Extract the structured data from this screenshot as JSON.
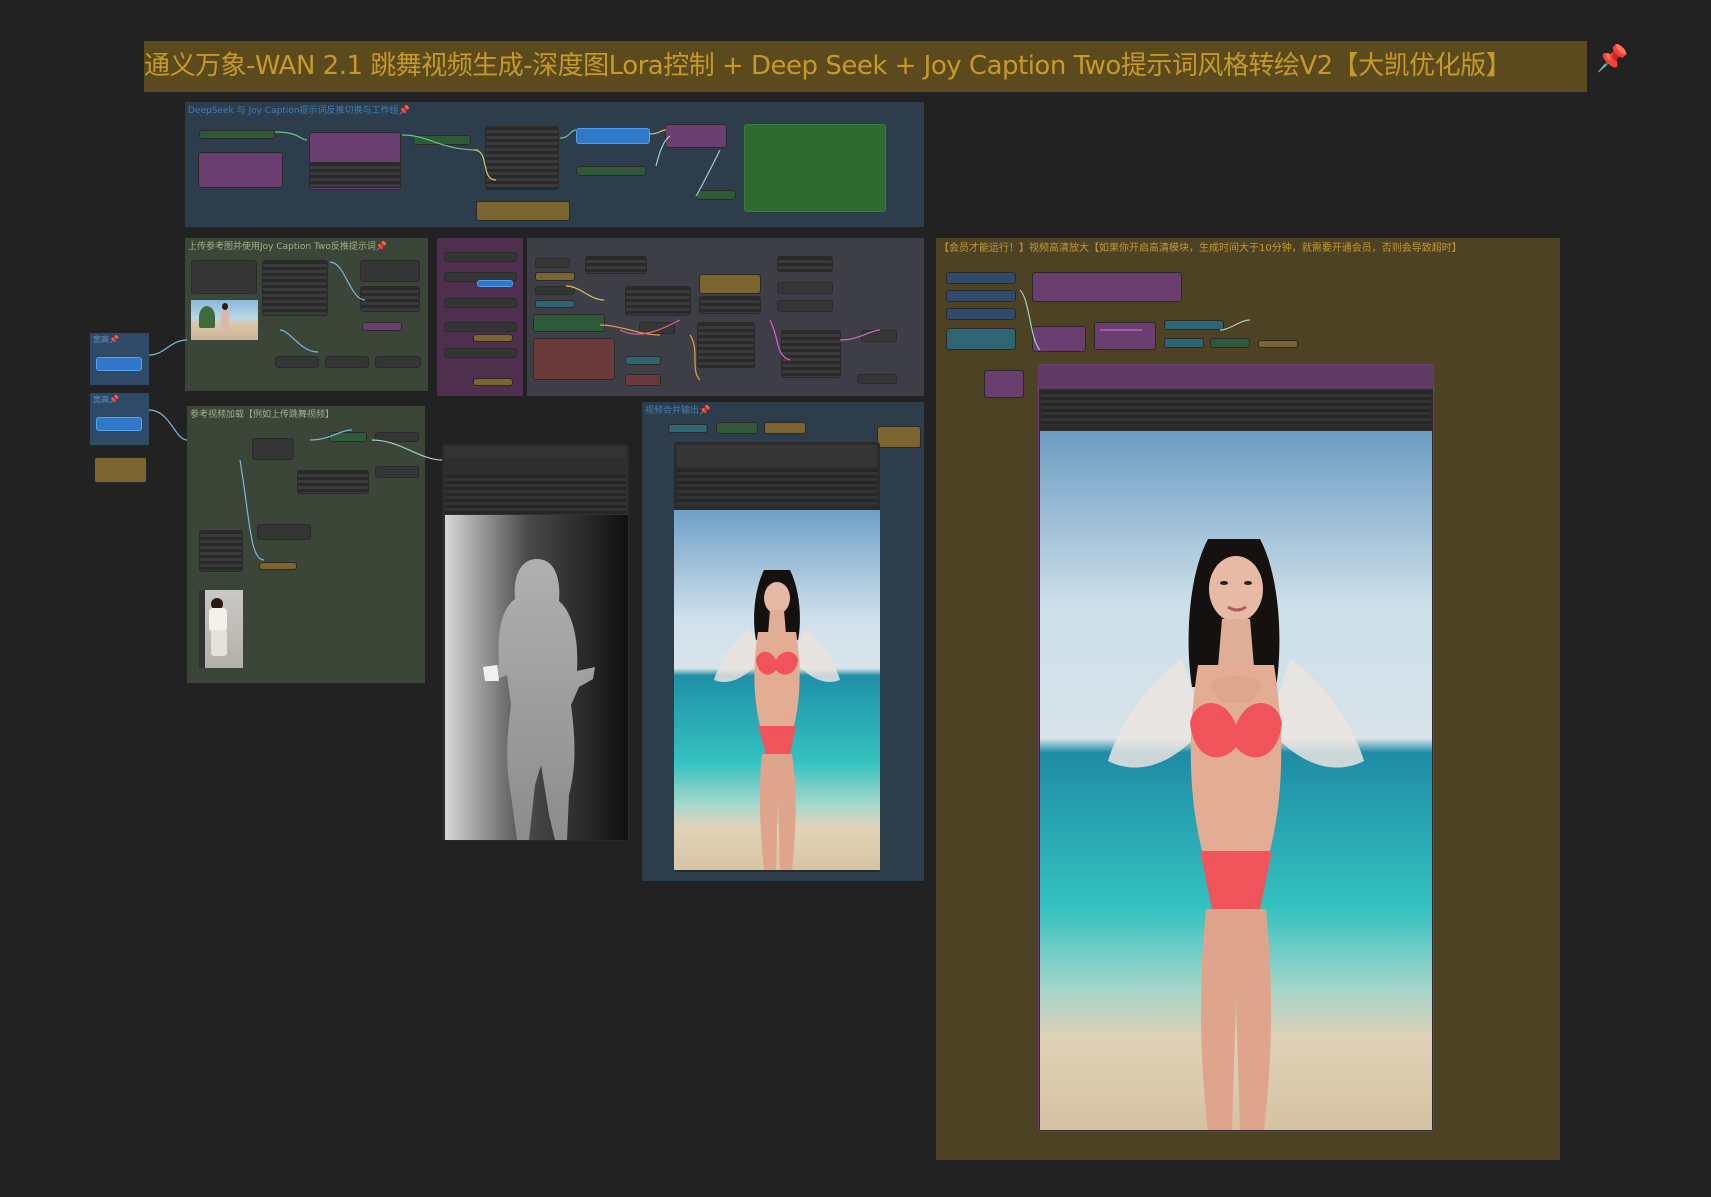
{
  "workflow": {
    "title": "通义万象-WAN 2.1 跳舞视频生成-深度图Lora控制 + Deep Seek + Joy Caption Two提示词风格转绘V2【大凯优化版】",
    "title_pin": "📌"
  },
  "groups": {
    "deepseek": {
      "title": "DeepSeek 与 Joy Caption提示词反推切换与工作组📌"
    },
    "upload_ref": {
      "title": "上传参考图并使用Joy Caption Two反推提示词📌"
    },
    "ref_video": {
      "title": "参考视频加载【例如上传跳舞视频】"
    },
    "video_merge": {
      "title": "视频合并输出📌"
    },
    "upscale": {
      "title": "【会员才能运行！】视频高清放大【如果你开启高清模块，生成时间大于10分钟，就需要开通会员，否则会导致超时】"
    },
    "side_a": {
      "title": "宽高📌"
    },
    "side_b": {
      "title": "宽高📌"
    }
  },
  "colors": {
    "canvas": "#222222",
    "title_bg": "#5a4a1e",
    "title_text": "#c79a28",
    "group_blue": "#2e3d4c",
    "group_green": "#3c4638",
    "group_purple": "#4e304e",
    "group_gray": "#3e3e46",
    "group_gold": "#4e4224"
  }
}
